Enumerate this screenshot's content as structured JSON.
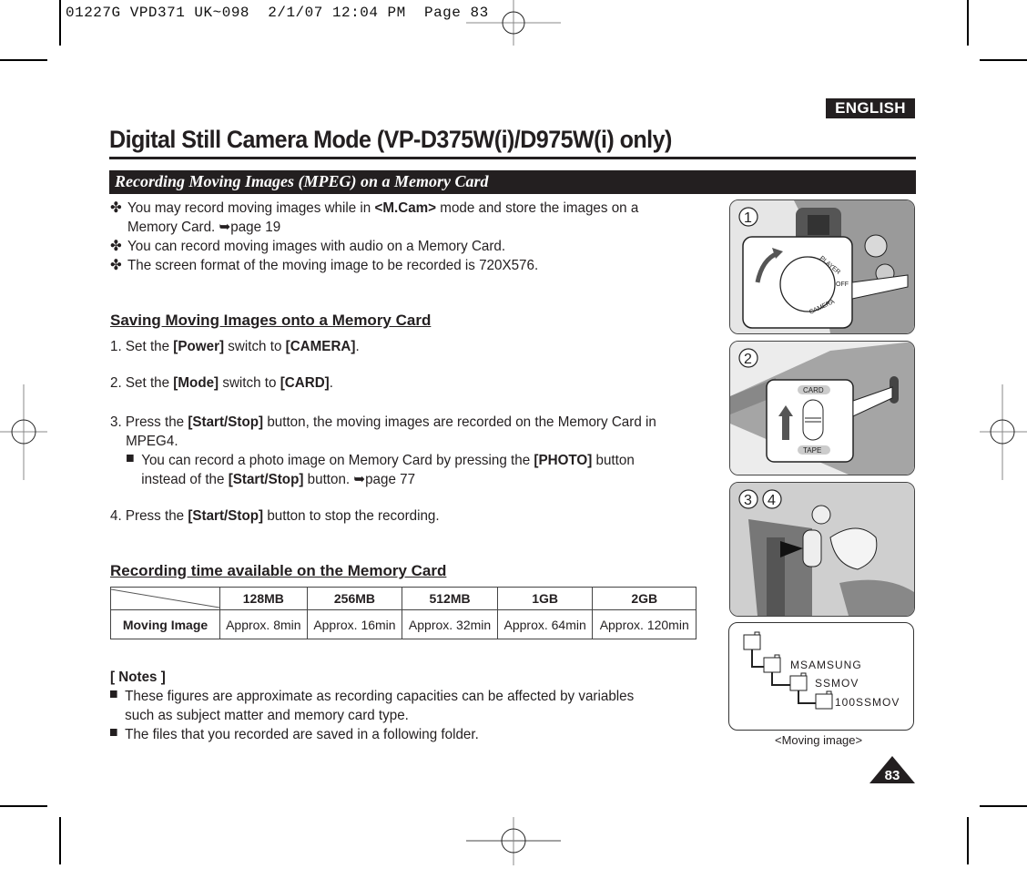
{
  "print_slug": "01227G VPD371 UK~098  2/1/07 12:04 PM  Page 83",
  "language_badge": "ENGLISH",
  "page_title": "Digital Still Camera Mode (VP-D375W(i)/D975W(i) only)",
  "section_title": "Recording Moving Images (MPEG) on a Memory Card",
  "intro_bullets": [
    {
      "glyph": "✤",
      "pre": "You may record moving images while in ",
      "bold": "<M.Cam>",
      "post": " mode and store the images on a",
      "line2": "Memory Card. ➥page 19"
    },
    {
      "glyph": "✤",
      "text": "You can record moving images with audio on a Memory Card."
    },
    {
      "glyph": "✤",
      "text": "The screen format of the moving image to be recorded is 720X576."
    }
  ],
  "saving": {
    "heading": "Saving Moving Images onto a Memory Card",
    "steps": [
      {
        "num": "1.",
        "p1": "Set the ",
        "b1": "[Power]",
        "p2": " switch to ",
        "b2": "[CAMERA]",
        "p3": "."
      },
      {
        "num": "2.",
        "p1": "Set the ",
        "b1": "[Mode]",
        "p2": " switch to ",
        "b2": "[CARD]",
        "p3": "."
      },
      {
        "num": "3.",
        "p1": "Press the ",
        "b1": "[Start/Stop]",
        "p2": " button, the moving images are recorded on the Memory Card in",
        "line2": "MPEG4.",
        "sub": {
          "p1": "You can record a photo image on Memory Card by pressing the ",
          "b1": "[PHOTO]",
          "p2": " button",
          "l2p1": "instead of the ",
          "l2b1": "[Start/Stop]",
          "l2p2": " button. ➥page 77"
        }
      },
      {
        "num": "4.",
        "p1": "Press the ",
        "b1": "[Start/Stop]",
        "p2": " button to stop the recording."
      }
    ]
  },
  "recording_time": {
    "heading": "Recording time available on the Memory Card",
    "columns": [
      "128MB",
      "256MB",
      "512MB",
      "1GB",
      "2GB"
    ],
    "row_label": "Moving Image",
    "values": [
      "Approx. 8min",
      "Approx. 16min",
      "Approx. 32min",
      "Approx. 64min",
      "Approx. 120min"
    ]
  },
  "notes": {
    "heading": "[ Notes ]",
    "items": [
      {
        "line1": "These figures are approximate as recording capacities can be affected by variables",
        "line2": "such as subject matter and memory card type."
      },
      {
        "line1": "The files that you recorded are saved in a following folder."
      }
    ]
  },
  "figures": {
    "fig1": {
      "step": "1",
      "dial_labels": [
        "PLAYER",
        "OFF",
        "CAMERA"
      ]
    },
    "fig2": {
      "step": "2",
      "switch_labels": [
        "CARD",
        "TAPE"
      ]
    },
    "fig3": {
      "steps": [
        "3",
        "4"
      ]
    }
  },
  "folder_tree": {
    "folders": [
      "MSAMSUNG",
      "SSMOV",
      "100SSMOV"
    ],
    "caption": "<Moving image>"
  },
  "page_number": "83"
}
